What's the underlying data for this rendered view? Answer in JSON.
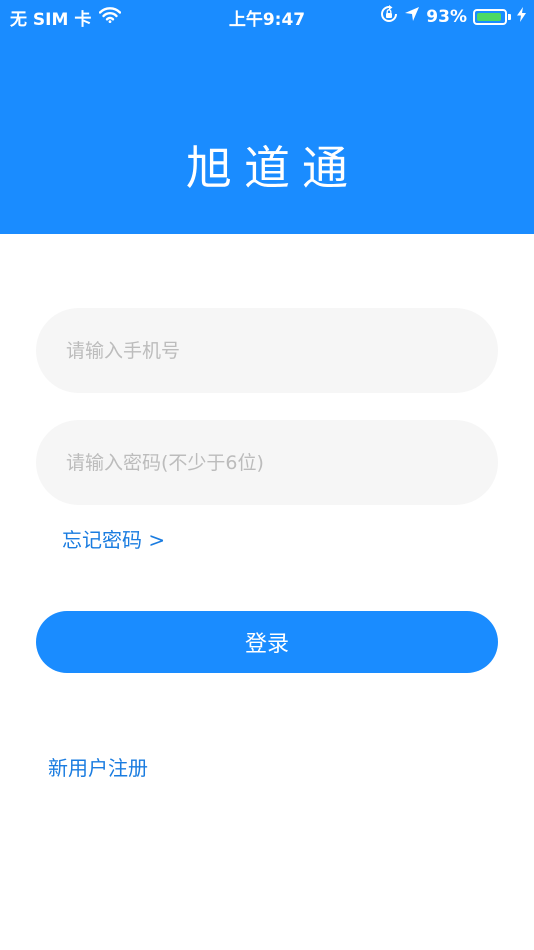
{
  "status_bar": {
    "carrier": "无 SIM 卡",
    "time": "上午9:47",
    "battery_percent": "93%",
    "battery_level": 0.93,
    "battery_color": "#4cd964"
  },
  "header": {
    "title": "旭道通",
    "background_color": "#1a8cff"
  },
  "form": {
    "phone_placeholder": "请输入手机号",
    "phone_value": "",
    "password_placeholder": "请输入密码(不少于6位)",
    "password_value": "",
    "forgot_password_label": "忘记密码 >",
    "login_label": "登录",
    "register_label": "新用户注册"
  },
  "colors": {
    "accent": "#1a8cff",
    "link": "#1a7ce0",
    "field_background": "#f6f6f6",
    "placeholder": "#bcbcbc"
  },
  "icons": [
    "wifi-icon",
    "rotation-lock-icon",
    "location-arrow-icon",
    "battery-icon",
    "charging-bolt-icon"
  ]
}
